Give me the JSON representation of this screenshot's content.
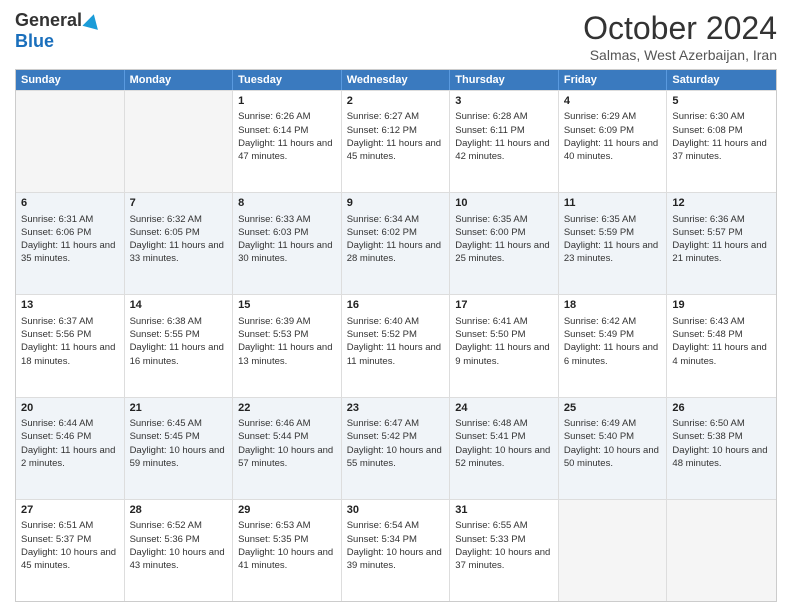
{
  "logo": {
    "general": "General",
    "blue": "Blue"
  },
  "header": {
    "month": "October 2024",
    "location": "Salmas, West Azerbaijan, Iran"
  },
  "days": [
    "Sunday",
    "Monday",
    "Tuesday",
    "Wednesday",
    "Thursday",
    "Friday",
    "Saturday"
  ],
  "weeks": [
    [
      {
        "day": "",
        "sunrise": "",
        "sunset": "",
        "daylight": ""
      },
      {
        "day": "",
        "sunrise": "",
        "sunset": "",
        "daylight": ""
      },
      {
        "day": "1",
        "sunrise": "Sunrise: 6:26 AM",
        "sunset": "Sunset: 6:14 PM",
        "daylight": "Daylight: 11 hours and 47 minutes."
      },
      {
        "day": "2",
        "sunrise": "Sunrise: 6:27 AM",
        "sunset": "Sunset: 6:12 PM",
        "daylight": "Daylight: 11 hours and 45 minutes."
      },
      {
        "day": "3",
        "sunrise": "Sunrise: 6:28 AM",
        "sunset": "Sunset: 6:11 PM",
        "daylight": "Daylight: 11 hours and 42 minutes."
      },
      {
        "day": "4",
        "sunrise": "Sunrise: 6:29 AM",
        "sunset": "Sunset: 6:09 PM",
        "daylight": "Daylight: 11 hours and 40 minutes."
      },
      {
        "day": "5",
        "sunrise": "Sunrise: 6:30 AM",
        "sunset": "Sunset: 6:08 PM",
        "daylight": "Daylight: 11 hours and 37 minutes."
      }
    ],
    [
      {
        "day": "6",
        "sunrise": "Sunrise: 6:31 AM",
        "sunset": "Sunset: 6:06 PM",
        "daylight": "Daylight: 11 hours and 35 minutes."
      },
      {
        "day": "7",
        "sunrise": "Sunrise: 6:32 AM",
        "sunset": "Sunset: 6:05 PM",
        "daylight": "Daylight: 11 hours and 33 minutes."
      },
      {
        "day": "8",
        "sunrise": "Sunrise: 6:33 AM",
        "sunset": "Sunset: 6:03 PM",
        "daylight": "Daylight: 11 hours and 30 minutes."
      },
      {
        "day": "9",
        "sunrise": "Sunrise: 6:34 AM",
        "sunset": "Sunset: 6:02 PM",
        "daylight": "Daylight: 11 hours and 28 minutes."
      },
      {
        "day": "10",
        "sunrise": "Sunrise: 6:35 AM",
        "sunset": "Sunset: 6:00 PM",
        "daylight": "Daylight: 11 hours and 25 minutes."
      },
      {
        "day": "11",
        "sunrise": "Sunrise: 6:35 AM",
        "sunset": "Sunset: 5:59 PM",
        "daylight": "Daylight: 11 hours and 23 minutes."
      },
      {
        "day": "12",
        "sunrise": "Sunrise: 6:36 AM",
        "sunset": "Sunset: 5:57 PM",
        "daylight": "Daylight: 11 hours and 21 minutes."
      }
    ],
    [
      {
        "day": "13",
        "sunrise": "Sunrise: 6:37 AM",
        "sunset": "Sunset: 5:56 PM",
        "daylight": "Daylight: 11 hours and 18 minutes."
      },
      {
        "day": "14",
        "sunrise": "Sunrise: 6:38 AM",
        "sunset": "Sunset: 5:55 PM",
        "daylight": "Daylight: 11 hours and 16 minutes."
      },
      {
        "day": "15",
        "sunrise": "Sunrise: 6:39 AM",
        "sunset": "Sunset: 5:53 PM",
        "daylight": "Daylight: 11 hours and 13 minutes."
      },
      {
        "day": "16",
        "sunrise": "Sunrise: 6:40 AM",
        "sunset": "Sunset: 5:52 PM",
        "daylight": "Daylight: 11 hours and 11 minutes."
      },
      {
        "day": "17",
        "sunrise": "Sunrise: 6:41 AM",
        "sunset": "Sunset: 5:50 PM",
        "daylight": "Daylight: 11 hours and 9 minutes."
      },
      {
        "day": "18",
        "sunrise": "Sunrise: 6:42 AM",
        "sunset": "Sunset: 5:49 PM",
        "daylight": "Daylight: 11 hours and 6 minutes."
      },
      {
        "day": "19",
        "sunrise": "Sunrise: 6:43 AM",
        "sunset": "Sunset: 5:48 PM",
        "daylight": "Daylight: 11 hours and 4 minutes."
      }
    ],
    [
      {
        "day": "20",
        "sunrise": "Sunrise: 6:44 AM",
        "sunset": "Sunset: 5:46 PM",
        "daylight": "Daylight: 11 hours and 2 minutes."
      },
      {
        "day": "21",
        "sunrise": "Sunrise: 6:45 AM",
        "sunset": "Sunset: 5:45 PM",
        "daylight": "Daylight: 10 hours and 59 minutes."
      },
      {
        "day": "22",
        "sunrise": "Sunrise: 6:46 AM",
        "sunset": "Sunset: 5:44 PM",
        "daylight": "Daylight: 10 hours and 57 minutes."
      },
      {
        "day": "23",
        "sunrise": "Sunrise: 6:47 AM",
        "sunset": "Sunset: 5:42 PM",
        "daylight": "Daylight: 10 hours and 55 minutes."
      },
      {
        "day": "24",
        "sunrise": "Sunrise: 6:48 AM",
        "sunset": "Sunset: 5:41 PM",
        "daylight": "Daylight: 10 hours and 52 minutes."
      },
      {
        "day": "25",
        "sunrise": "Sunrise: 6:49 AM",
        "sunset": "Sunset: 5:40 PM",
        "daylight": "Daylight: 10 hours and 50 minutes."
      },
      {
        "day": "26",
        "sunrise": "Sunrise: 6:50 AM",
        "sunset": "Sunset: 5:38 PM",
        "daylight": "Daylight: 10 hours and 48 minutes."
      }
    ],
    [
      {
        "day": "27",
        "sunrise": "Sunrise: 6:51 AM",
        "sunset": "Sunset: 5:37 PM",
        "daylight": "Daylight: 10 hours and 45 minutes."
      },
      {
        "day": "28",
        "sunrise": "Sunrise: 6:52 AM",
        "sunset": "Sunset: 5:36 PM",
        "daylight": "Daylight: 10 hours and 43 minutes."
      },
      {
        "day": "29",
        "sunrise": "Sunrise: 6:53 AM",
        "sunset": "Sunset: 5:35 PM",
        "daylight": "Daylight: 10 hours and 41 minutes."
      },
      {
        "day": "30",
        "sunrise": "Sunrise: 6:54 AM",
        "sunset": "Sunset: 5:34 PM",
        "daylight": "Daylight: 10 hours and 39 minutes."
      },
      {
        "day": "31",
        "sunrise": "Sunrise: 6:55 AM",
        "sunset": "Sunset: 5:33 PM",
        "daylight": "Daylight: 10 hours and 37 minutes."
      },
      {
        "day": "",
        "sunrise": "",
        "sunset": "",
        "daylight": ""
      },
      {
        "day": "",
        "sunrise": "",
        "sunset": "",
        "daylight": ""
      }
    ]
  ]
}
